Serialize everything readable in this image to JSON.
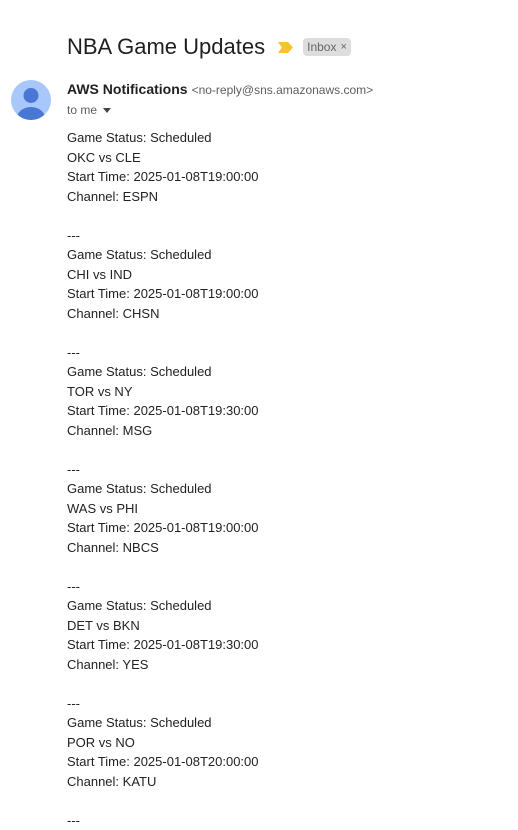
{
  "email": {
    "subject": "NBA Game Updates",
    "label": "Inbox",
    "label_close": "×",
    "sender_name": "AWS Notifications",
    "sender_email": "<no-reply@sns.amazonaws.com>",
    "recipient": "to me",
    "separator": "---",
    "games": [
      {
        "status": "Game Status: Scheduled",
        "matchup": "OKC vs CLE",
        "start": "Start Time: 2025-01-08T19:00:00",
        "channel": "Channel: ESPN"
      },
      {
        "status": "Game Status: Scheduled",
        "matchup": "CHI vs IND",
        "start": "Start Time: 2025-01-08T19:00:00",
        "channel": "Channel: CHSN"
      },
      {
        "status": "Game Status: Scheduled",
        "matchup": "TOR vs NY",
        "start": "Start Time: 2025-01-08T19:30:00",
        "channel": "Channel: MSG"
      },
      {
        "status": "Game Status: Scheduled",
        "matchup": "WAS vs PHI",
        "start": "Start Time: 2025-01-08T19:00:00",
        "channel": "Channel: NBCS"
      },
      {
        "status": "Game Status: Scheduled",
        "matchup": "DET vs BKN",
        "start": "Start Time: 2025-01-08T19:30:00",
        "channel": "Channel: YES"
      },
      {
        "status": "Game Status: Scheduled",
        "matchup": "POR vs NO",
        "start": "Start Time: 2025-01-08T20:00:00",
        "channel": "Channel: KATU"
      }
    ]
  },
  "colors": {
    "importance_marker": "#f4c430",
    "avatar_bg": "#a8c7fa",
    "avatar_fg": "#4a77d4",
    "label_bg": "#dddddd"
  },
  "icons": {
    "importance": "importance-marker-icon",
    "avatar": "default-avatar-icon",
    "expand": "caret-down-icon"
  }
}
